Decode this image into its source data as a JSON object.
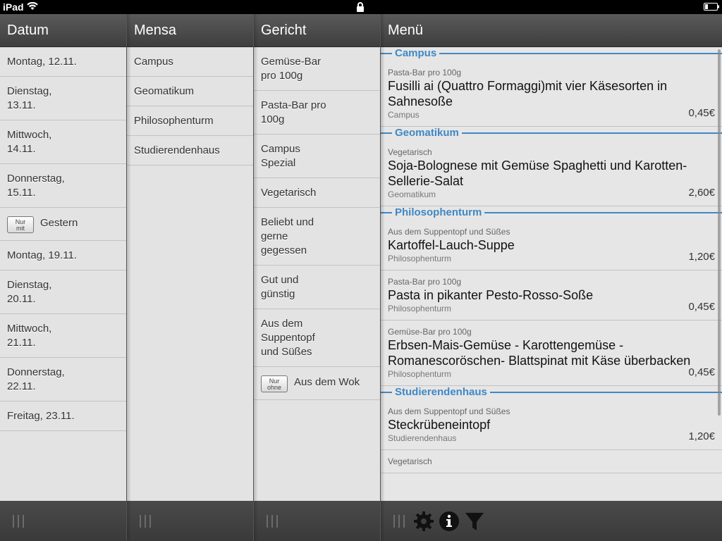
{
  "statusbar": {
    "device": "iPad"
  },
  "columns": {
    "datum": {
      "title": "Datum",
      "items": [
        {
          "label": "Montag, 12.11."
        },
        {
          "label": "Dienstag,\n13.11."
        },
        {
          "label": "Mittwoch,\n14.11."
        },
        {
          "label": "Donnerstag,\n15.11."
        },
        {
          "label": "Gestern",
          "button": "Nur\nmit"
        },
        {
          "label": "Montag, 19.11."
        },
        {
          "label": "Dienstag,\n20.11."
        },
        {
          "label": "Mittwoch,\n21.11."
        },
        {
          "label": "Donnerstag,\n22.11."
        },
        {
          "label": "Freitag, 23.11."
        }
      ]
    },
    "mensa": {
      "title": "Mensa",
      "items": [
        {
          "label": "Campus"
        },
        {
          "label": "Geomatikum"
        },
        {
          "label": "Philosophenturm"
        },
        {
          "label": "Studierendenhaus"
        }
      ]
    },
    "gericht": {
      "title": "Gericht",
      "items": [
        {
          "label": "Gemüse-Bar\npro 100g"
        },
        {
          "label": "Pasta-Bar pro\n100g"
        },
        {
          "label": "Campus\nSpezial"
        },
        {
          "label": "Vegetarisch"
        },
        {
          "label": "Beliebt und\ngerne\ngegessen"
        },
        {
          "label": "Gut und\ngünstig"
        },
        {
          "label": "Aus dem\nSuppentopf\nund Süßes"
        },
        {
          "label": "Aus dem Wok",
          "button": "Nur\nohne"
        }
      ]
    },
    "menu": {
      "title": "Menü",
      "sections": [
        {
          "title": "Campus",
          "items": [
            {
              "category": "Pasta-Bar pro 100g",
              "name": "Fusilli ai (Quattro Formaggi)mit vier Käsesorten in Sahnesoße",
              "mensa": "Campus",
              "price": "0,45€"
            }
          ]
        },
        {
          "title": "Geomatikum",
          "items": [
            {
              "category": "Vegetarisch",
              "name": "Soja-Bolognese mit Gemüse Spaghetti und Karotten-Sellerie-Salat",
              "mensa": "Geomatikum",
              "price": "2,60€"
            }
          ]
        },
        {
          "title": "Philosophenturm",
          "items": [
            {
              "category": "Aus dem Suppentopf und Süßes",
              "name": "Kartoffel-Lauch-Suppe",
              "mensa": "Philosophenturm",
              "price": "1,20€"
            },
            {
              "category": "Pasta-Bar pro 100g",
              "name": "Pasta in pikanter Pesto-Rosso-Soße",
              "mensa": "Philosophenturm",
              "price": "0,45€"
            },
            {
              "category": "Gemüse-Bar pro 100g",
              "name": "Erbsen-Mais-Gemüse - Karottengemüse - Romanescoröschen- Blattspinat mit Käse überbacken",
              "mensa": "Philosophenturm",
              "price": "0,45€"
            }
          ]
        },
        {
          "title": "Studierendenhaus",
          "items": [
            {
              "category": "Aus dem Suppentopf und Süßes",
              "name": "Steckrübeneintopf",
              "mensa": "Studierendenhaus",
              "price": "1,20€"
            },
            {
              "category": "Vegetarisch",
              "name": "",
              "mensa": "",
              "price": ""
            }
          ]
        }
      ]
    }
  },
  "footer_icons": [
    "gear-icon",
    "info-icon",
    "filter-icon"
  ],
  "colors": {
    "accent": "#3f88c5",
    "header": "#4a4a4a",
    "list_bg": "#e3e3e3"
  }
}
